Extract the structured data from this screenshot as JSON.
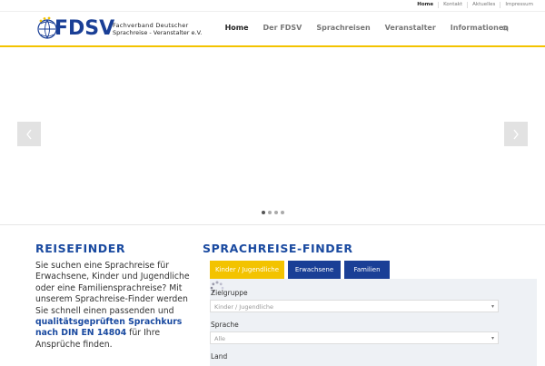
{
  "top_links": [
    "Home",
    "Kontakt",
    "Aktuelles",
    "Impressum"
  ],
  "logo": {
    "word": "FDSV",
    "line1": "Fachverband Deutscher",
    "line2": "Sprachreise - Veranstalter e.V."
  },
  "nav": {
    "items": [
      "Home",
      "Der FDSV",
      "Sprachreisen",
      "Veranstalter",
      "Informationen"
    ],
    "active": "Home"
  },
  "slider": {
    "dot_count": 4,
    "active_dot": 0
  },
  "reisefinder": {
    "title": "REISEFINDER",
    "text_before": "Sie suchen eine Sprachreise für Erwachsene, Kinder und Jugendliche oder eine Familiensprachreise? Mit unserem Sprachreise-Finder werden Sie schnell einen passenden und ",
    "highlight": "qualitätsgeprüften Sprachkurs nach DIN EN 14804",
    "text_after": " für Ihre Ansprüche finden."
  },
  "sprachreise_finder": {
    "title": "SPRACHREISE-FINDER",
    "tabs": [
      "Kinder / Jugendliche",
      "Erwachsene",
      "Familien"
    ],
    "fields": {
      "zielgruppe_label": "Zielgruppe",
      "zielgruppe_value": "Kinder / Jugendliche",
      "sprache_label": "Sprache",
      "sprache_value": "Alle",
      "land_label": "Land"
    }
  },
  "colors": {
    "brand_blue": "#1a3f96",
    "accent_yellow": "#f3c300"
  }
}
